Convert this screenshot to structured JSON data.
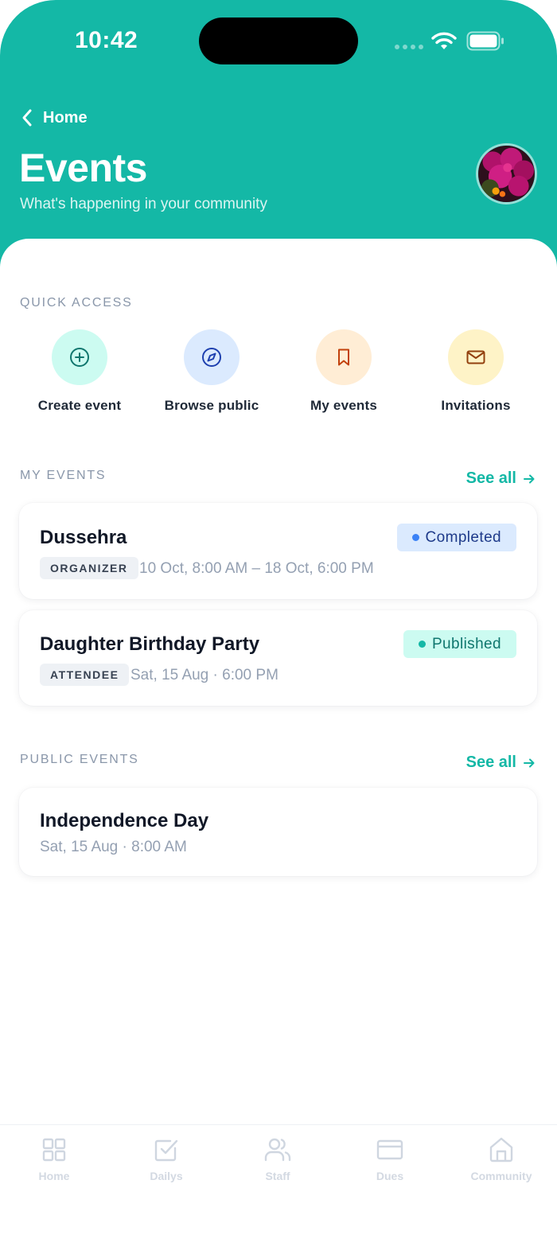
{
  "status_bar": {
    "time": "10:42"
  },
  "header": {
    "back_label": "Home",
    "title": "Events",
    "subtitle": "What's happening in your community"
  },
  "quick_access": {
    "label": "QUICK ACCESS",
    "items": [
      {
        "label": "Create event",
        "icon": "plus-circle-icon",
        "bg": "#ccfbf1",
        "fg": "#0f766e"
      },
      {
        "label": "Browse public",
        "icon": "compass-icon",
        "bg": "#dbeafe",
        "fg": "#1e40af"
      },
      {
        "label": "My events",
        "icon": "bookmark-icon",
        "bg": "#ffedd5",
        "fg": "#c2410c"
      },
      {
        "label": "Invitations",
        "icon": "mail-icon",
        "bg": "#fef3c7",
        "fg": "#92400e"
      }
    ]
  },
  "my_events": {
    "label": "MY EVENTS",
    "see_all": "See all",
    "items": [
      {
        "title": "Dussehra",
        "role": "ORGANIZER",
        "when": "10 Oct, 8:00 AM – 18 Oct, 6:00 PM",
        "status": "Completed",
        "status_bg": "#dbeafe",
        "status_fg": "#1e3a8a",
        "status_dot": "#3b82f6"
      },
      {
        "title": "Daughter Birthday Party",
        "role": "ATTENDEE",
        "when": "Sat, 15 Aug · 6:00 PM",
        "status": "Published",
        "status_bg": "#ccfbf1",
        "status_fg": "#0f766e",
        "status_dot": "#14b8a6"
      }
    ]
  },
  "public_events": {
    "label": "PUBLIC EVENTS",
    "see_all": "See all",
    "items": [
      {
        "title": "Independence Day",
        "when": "Sat, 15 Aug · 8:00 AM"
      }
    ]
  },
  "tabbar": {
    "items": [
      {
        "label": "Home",
        "icon": "grid-icon"
      },
      {
        "label": "Dailys",
        "icon": "checkbox-icon"
      },
      {
        "label": "Staff",
        "icon": "users-icon"
      },
      {
        "label": "Dues",
        "icon": "card-icon"
      },
      {
        "label": "Community",
        "icon": "house-icon"
      }
    ]
  },
  "colors": {
    "accent": "#14b8a6",
    "muted": "#94a0b2"
  }
}
